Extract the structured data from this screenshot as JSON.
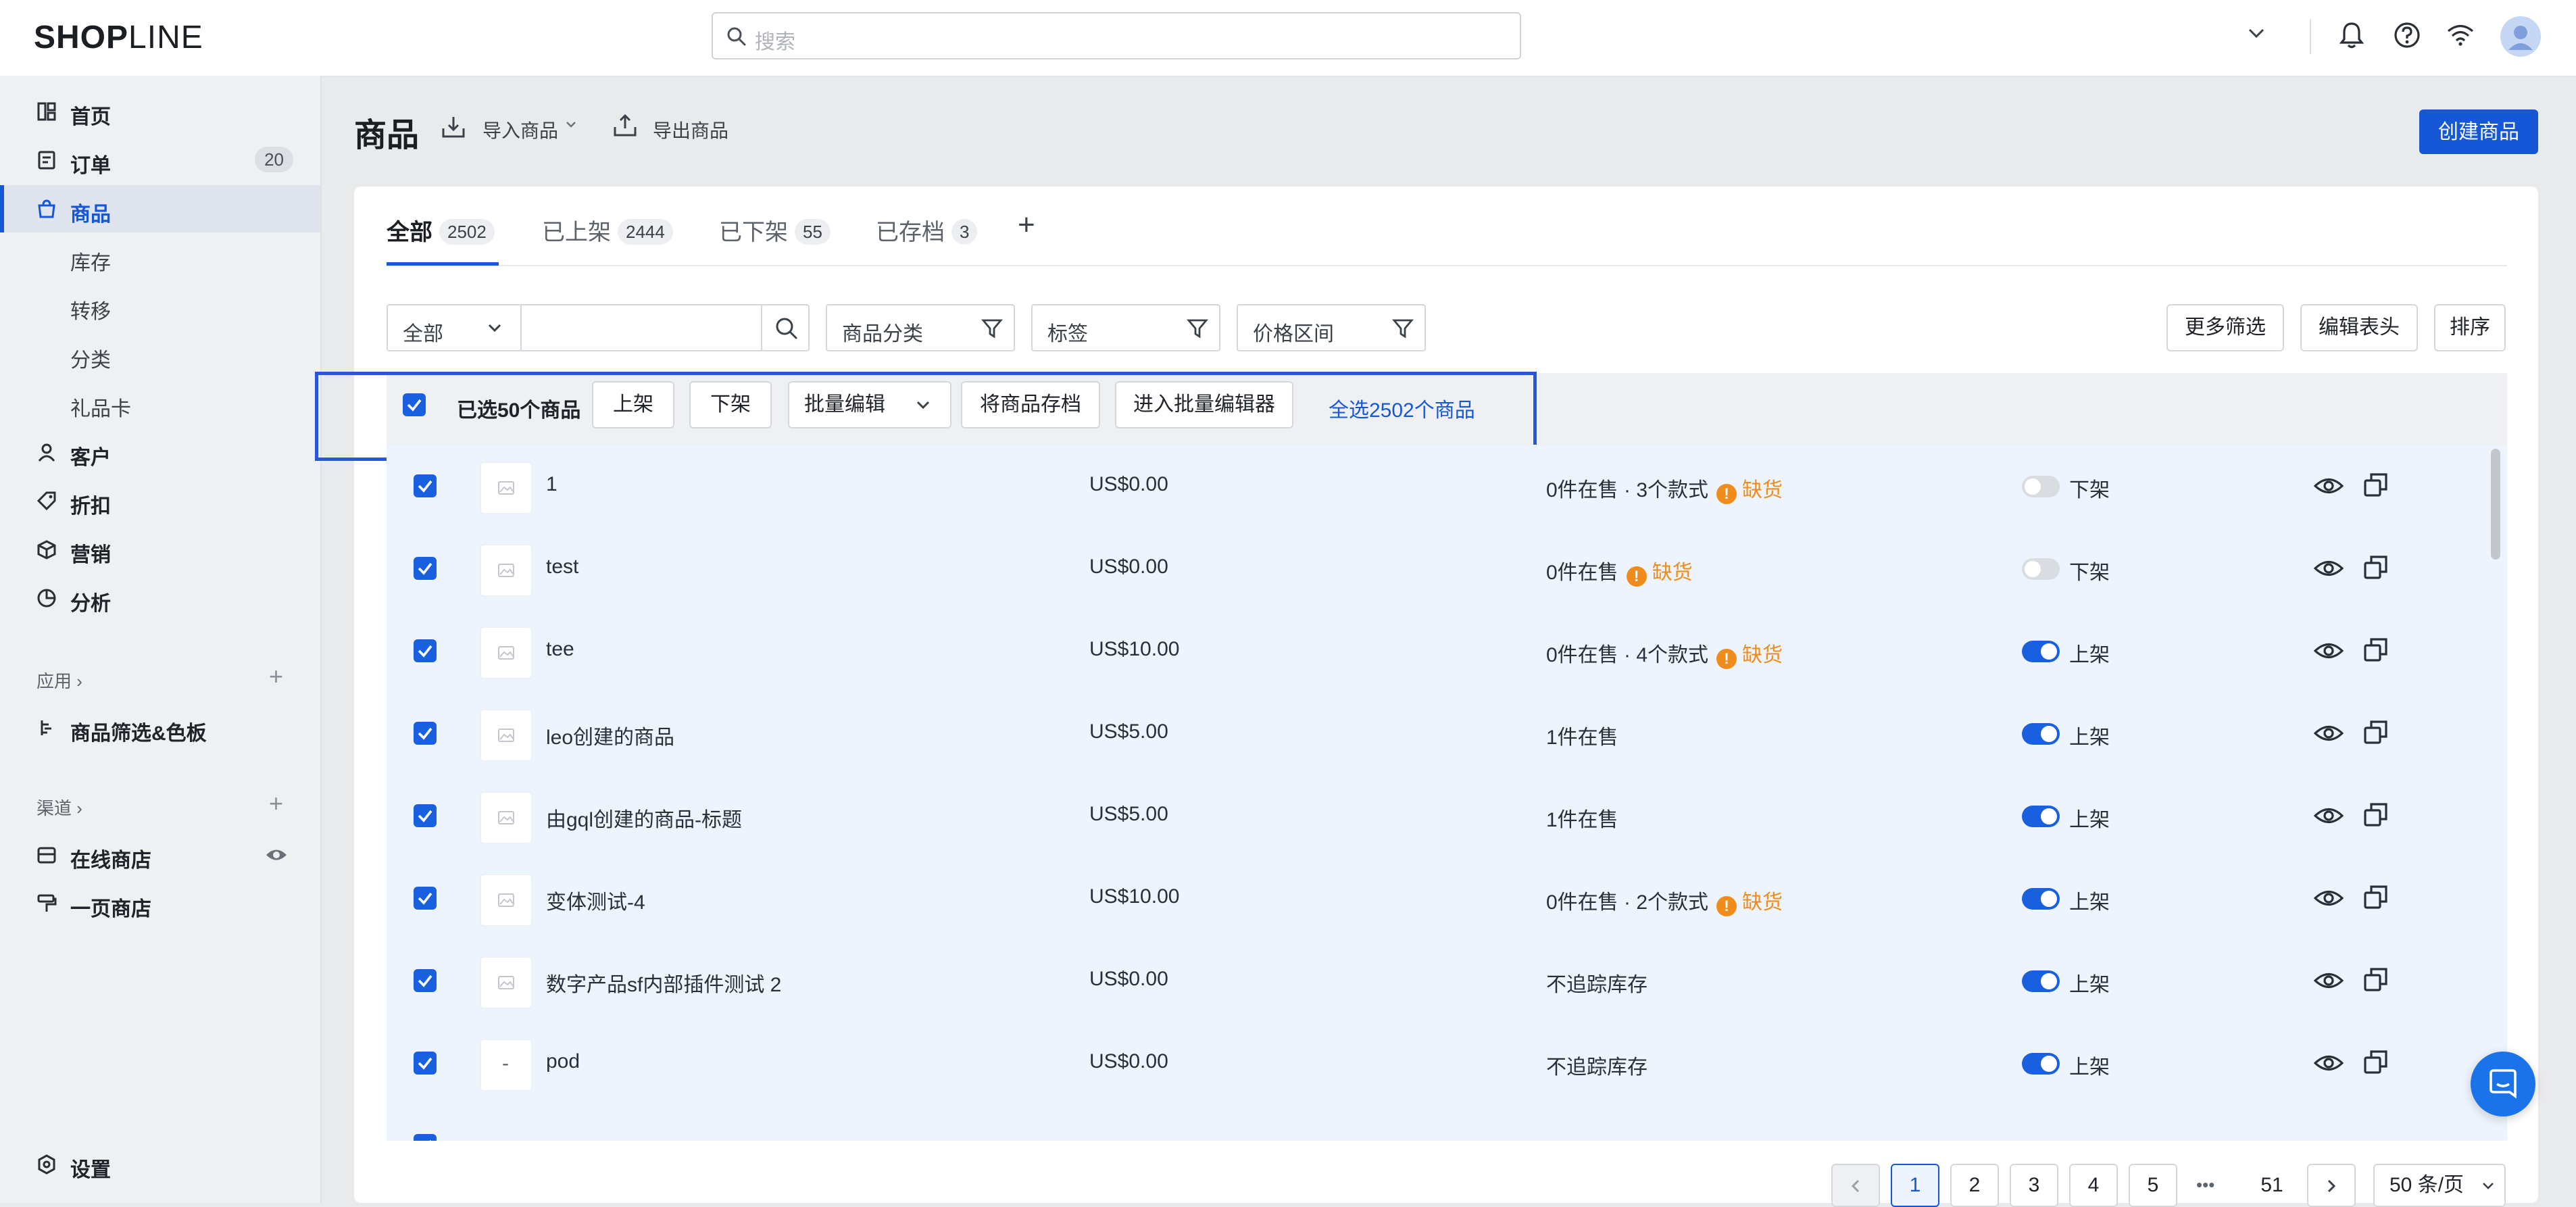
{
  "app": {
    "logo_bold": "SHOP",
    "logo_thin": "LINE",
    "search_placeholder": "搜索"
  },
  "sidebar": {
    "items": [
      {
        "label": "首页",
        "icon": "layout-icon"
      },
      {
        "label": "订单",
        "icon": "order-icon",
        "badge": "20"
      },
      {
        "label": "商品",
        "icon": "bag-icon",
        "active": true
      },
      {
        "label": "库存"
      },
      {
        "label": "转移"
      },
      {
        "label": "分类"
      },
      {
        "label": "礼品卡"
      },
      {
        "label": "客户",
        "icon": "user-icon"
      },
      {
        "label": "折扣",
        "icon": "tag-icon"
      },
      {
        "label": "营销",
        "icon": "cube-icon"
      },
      {
        "label": "分析",
        "icon": "pie-icon"
      }
    ],
    "apps_section": "应用 ›",
    "apps_item": "商品筛选&色板",
    "channels_section": "渠道 ›",
    "channel_online": "在线商店",
    "channel_onepage": "一页商店",
    "settings": "设置"
  },
  "header": {
    "title": "商品",
    "import": "导入商品",
    "export": "导出商品",
    "create": "创建商品"
  },
  "tabs": [
    {
      "label": "全部",
      "count": "2502"
    },
    {
      "label": "已上架",
      "count": "2444"
    },
    {
      "label": "已下架",
      "count": "55"
    },
    {
      "label": "已存档",
      "count": "3"
    }
  ],
  "filters": {
    "scope": "全部",
    "category": "商品分类",
    "tag": "标签",
    "price": "价格区间",
    "more": "更多筛选",
    "edit_columns": "编辑表头",
    "sort": "排序"
  },
  "bulk": {
    "selected": "已选50个商品",
    "publish": "上架",
    "unpublish": "下架",
    "batch_edit": "批量编辑",
    "archive": "将商品存档",
    "bulk_editor": "进入批量编辑器",
    "select_all": "全选2502个商品"
  },
  "products": [
    {
      "name": "1",
      "price": "US$0.00",
      "stock": "0件在售 · 3个款式",
      "out": "缺货",
      "status": "下架",
      "on": false
    },
    {
      "name": "test",
      "price": "US$0.00",
      "stock": "0件在售",
      "out": "缺货",
      "status": "下架",
      "on": false
    },
    {
      "name": "tee",
      "price": "US$10.00",
      "stock": "0件在售 · 4个款式",
      "out": "缺货",
      "status": "上架",
      "on": true
    },
    {
      "name": "leo创建的商品",
      "price": "US$5.00",
      "stock": "1件在售",
      "out": "",
      "status": "上架",
      "on": true
    },
    {
      "name": "由gql创建的商品-标题",
      "price": "US$5.00",
      "stock": "1件在售",
      "out": "",
      "status": "上架",
      "on": true
    },
    {
      "name": "变体测试-4",
      "price": "US$10.00",
      "stock": "0件在售 · 2个款式",
      "out": "缺货",
      "status": "上架",
      "on": true
    },
    {
      "name": "数字产品sf内部插件测试 2",
      "price": "US$0.00",
      "stock": "不追踪库存",
      "out": "",
      "status": "上架",
      "on": true
    },
    {
      "name": "pod",
      "price": "US$0.00",
      "stock": "不追踪库存",
      "out": "",
      "status": "上架",
      "on": true,
      "thumb_text": "-"
    }
  ],
  "pagination": {
    "pages": [
      "1",
      "2",
      "3",
      "4",
      "5"
    ],
    "ellipsis": "•••",
    "last": "51",
    "page_size": "50 条/页",
    "current": "1"
  },
  "colors": {
    "accent": "#1557d6",
    "warning": "#f08c1c",
    "selected_row": "#eef4fd"
  }
}
